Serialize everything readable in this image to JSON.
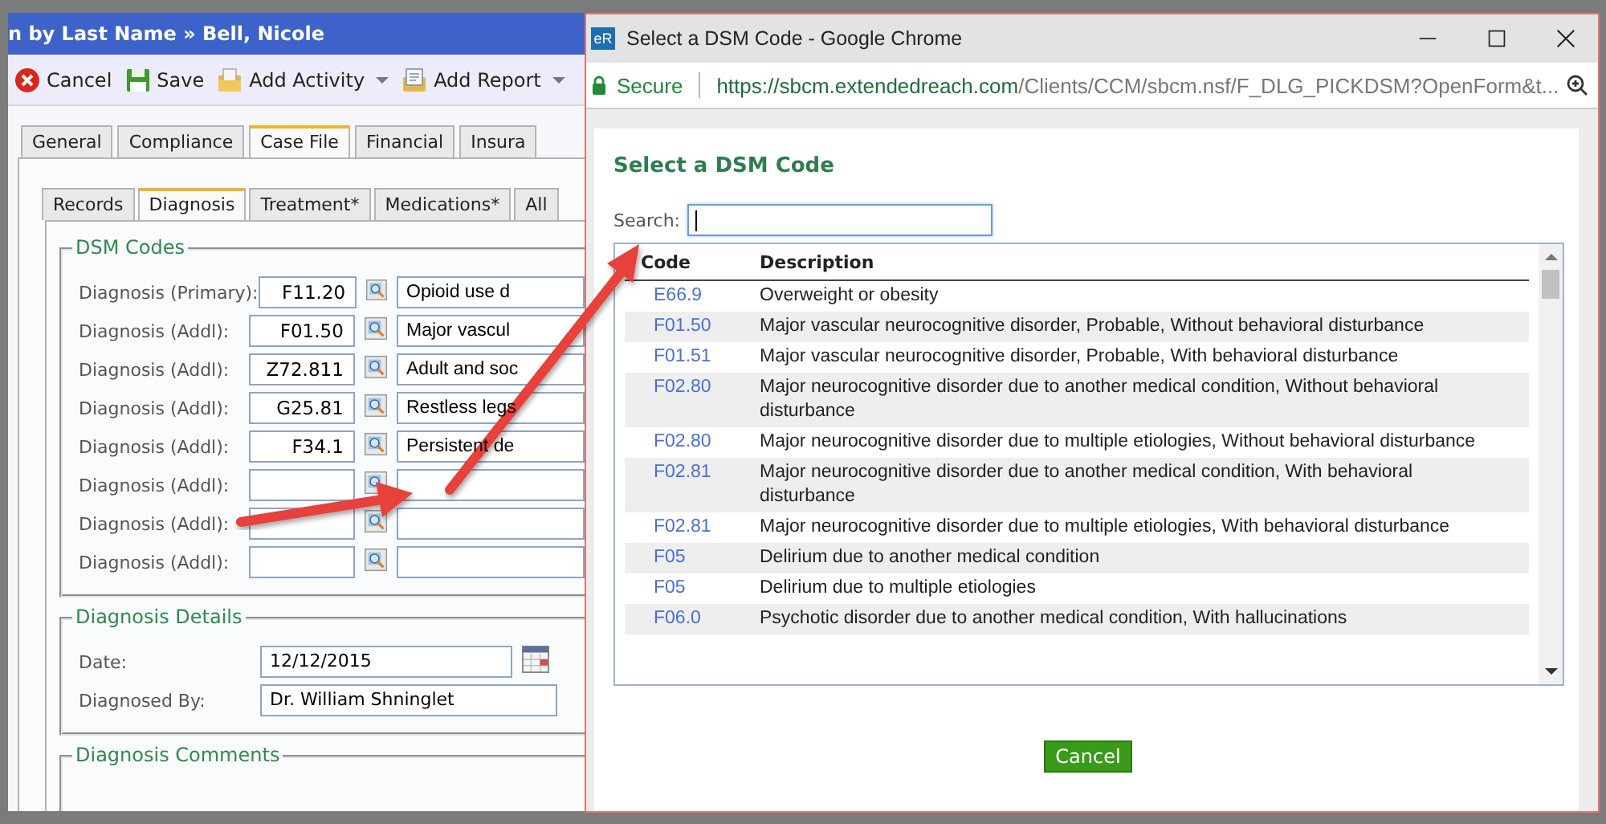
{
  "breadcrumb": "n by Last Name » Bell, Nicole",
  "toolbar": [
    {
      "label": "Cancel",
      "kind": "cancel",
      "dropdown": false
    },
    {
      "label": "Save",
      "kind": "save",
      "dropdown": false
    },
    {
      "label": "Add Activity",
      "kind": "activity",
      "dropdown": true
    },
    {
      "label": "Add Report",
      "kind": "report",
      "dropdown": true
    }
  ],
  "tabs": [
    {
      "label": "General",
      "selected": false
    },
    {
      "label": "Compliance",
      "selected": false
    },
    {
      "label": "Case File",
      "selected": true
    },
    {
      "label": "Financial",
      "selected": false
    },
    {
      "label": "Insura",
      "selected": false
    }
  ],
  "subtabs": [
    {
      "label": "Records",
      "selected": false
    },
    {
      "label": "Diagnosis",
      "selected": true
    },
    {
      "label": "Treatment*",
      "selected": false
    },
    {
      "label": "Medications*",
      "selected": false
    },
    {
      "label": "All",
      "selected": false
    }
  ],
  "dsm_codes": {
    "legend": "DSM Codes",
    "rows": [
      {
        "label": "Diagnosis (Primary):",
        "code": "F11.20",
        "description": "Opioid use d"
      },
      {
        "label": "Diagnosis (Addl):",
        "code": "F01.50",
        "description": "Major vascul"
      },
      {
        "label": "Diagnosis (Addl):",
        "code": "Z72.811",
        "description": "Adult and soc"
      },
      {
        "label": "Diagnosis (Addl):",
        "code": "G25.81",
        "description": "Restless legs"
      },
      {
        "label": "Diagnosis (Addl):",
        "code": "F34.1",
        "description": "Persistent de"
      },
      {
        "label": "Diagnosis (Addl):"
      },
      {
        "label": "Diagnosis (Addl):"
      },
      {
        "label": "Diagnosis (Addl):"
      }
    ]
  },
  "details": {
    "legend": "Diagnosis Details",
    "date_label": "Date:",
    "date": "12/12/2015",
    "by_label": "Diagnosed By:",
    "by": "Dr. William Shninglet"
  },
  "comments": {
    "legend": "Diagnosis Comments"
  },
  "popup": {
    "app_icon": "eR",
    "title": "Select a DSM Code - Google Chrome",
    "secure": "Secure",
    "url_host": "https://sbcm.extendedreach.com",
    "url_path": "/Clients/CCM/sbcm.nsf/F_DLG_PICKDSM?OpenForm&t...",
    "heading": "Select a DSM Code",
    "search_label": "Search:",
    "search_focused": true,
    "columns": [
      "Code",
      "Description"
    ],
    "rows": [
      {
        "code": "E66.9",
        "description": "Overweight or obesity"
      },
      {
        "code": "F01.50",
        "description": "Major vascular neurocognitive disorder, Probable, Without behavioral disturbance"
      },
      {
        "code": "F01.51",
        "description": "Major vascular neurocognitive disorder, Probable, With behavioral disturbance"
      },
      {
        "code": "F02.80",
        "description": "Major neurocognitive disorder due to another medical condition, Without behavioral disturbance"
      },
      {
        "code": "F02.80",
        "description": "Major neurocognitive disorder due to multiple etiologies, Without behavioral disturbance"
      },
      {
        "code": "F02.81",
        "description": "Major neurocognitive disorder due to another medical condition, With behavioral disturbance"
      },
      {
        "code": "F02.81",
        "description": "Major neurocognitive disorder due to multiple etiologies, With behavioral disturbance"
      },
      {
        "code": "F05",
        "description": "Delirium due to another medical condition"
      },
      {
        "code": "F05",
        "description": "Delirium due to multiple etiologies"
      },
      {
        "code": "F06.0",
        "description": "Psychotic disorder due to another medical condition, With hallucinations"
      }
    ],
    "cancel": "Cancel"
  }
}
